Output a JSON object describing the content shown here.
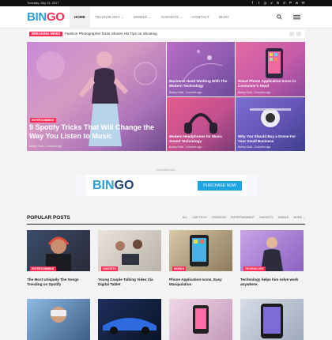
{
  "topbar": {
    "date": "Tuesday, July 11, 2017",
    "social": [
      "f",
      "t",
      "g",
      "v",
      "in",
      "d",
      "P",
      "w",
      "✉"
    ]
  },
  "brand": {
    "logo_a": "BIN",
    "logo_b": "GO"
  },
  "nav": [
    "HOME",
    "TECHNOLOGY ⌄",
    "MOBILE ⌄",
    "GADGETS ⌄",
    "CONTACT",
    "BLOG"
  ],
  "ticker": {
    "label": "BREAKING NEWS",
    "text": "Fashion Photographer Dans Shares His Tips on Shooting",
    "prev": "‹",
    "next": "›"
  },
  "hero": {
    "main": {
      "category": "ENTERTAINMENT",
      "title": "9 Spotify Tricks That Will Change the Way You Listen to Music",
      "meta": "Bobby Glatt  -  3 months ago"
    },
    "t2": {
      "title": "Business Hand Working With The Modern Technology",
      "meta": "Bobby Glatt  -  3 months ago"
    },
    "t3": {
      "title": "Smart Phone Application Icons in Consumer's Hand",
      "meta": "Bobby Glatt  -  3 months ago"
    },
    "t4": {
      "title": "Modern Headphones for Music Sound Technology",
      "meta": "Bobby Glatt  -  3 months ago"
    },
    "t5": {
      "title": "Why You Should Buy a Drone For Your Small Business",
      "meta": "Bobby Glatt  -  3 months ago"
    }
  },
  "ad": {
    "label": "- Advertisement -",
    "logo_a": "BIN",
    "logo_b": "GO",
    "cta": "PURCHASE NOW"
  },
  "popular": {
    "title": "POPULAR POSTS",
    "tabs": [
      "ALL",
      "CAR TECH",
      "CREATION",
      "ENTERTAINMENT",
      "GADGETS",
      "MOBILE",
      "MORE ⌄"
    ],
    "cards": [
      {
        "category": "ENTERTAINMENT",
        "title": "The Most Uniquely The Songs Trending on Spotify"
      },
      {
        "category": "GADGETS",
        "title": "Young Couple Talking Video Via Digital Tablet"
      },
      {
        "category": "MOBILE",
        "title": "Phone Application Icons, Easy Manipulation"
      },
      {
        "category": "TECHNOLOGY",
        "title": "Technology helps him solve work anywhere."
      }
    ]
  },
  "colors": {
    "accent": "#ff2b54",
    "brand_blue": "#2a9fd6"
  }
}
